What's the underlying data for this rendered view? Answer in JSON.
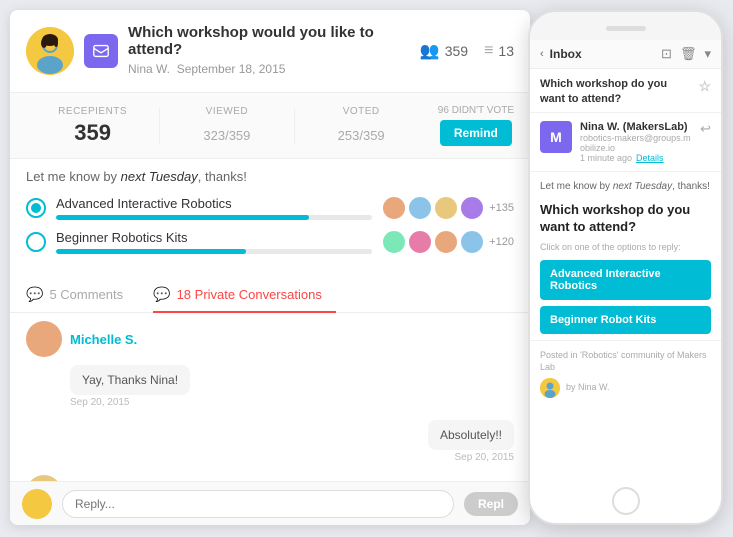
{
  "header": {
    "question": "Which workshop would you like to attend?",
    "author": "Nina W.",
    "date": "September 18, 2015",
    "recipients_count": "359",
    "list_count": "13"
  },
  "stats": {
    "recipients_label": "RECEPIENTS",
    "recipients_value": "359",
    "viewed_label": "VIEWED",
    "viewed_value": "323",
    "viewed_total": "/359",
    "voted_label": "VOTED",
    "voted_value": "253",
    "voted_total": "/359",
    "didnt_vote_label": "96 DIDN'T VOTE",
    "remind_btn": "Remind"
  },
  "poll": {
    "message_before": "Let me know by ",
    "message_italic": "next Tuesday",
    "message_after": ", thanks!",
    "options": [
      {
        "label": "Advanced Interactive Robotics",
        "fill_pct": 80,
        "count": "+135",
        "selected": true
      },
      {
        "label": "Beginner Robotics Kits",
        "fill_pct": 60,
        "count": "+120",
        "selected": false
      }
    ]
  },
  "tabs": [
    {
      "label": "5 Comments",
      "active": false,
      "icon": "💬"
    },
    {
      "label": "18 Private Conversations",
      "active": true,
      "icon": "💬"
    }
  ],
  "comments": [
    {
      "username": "Michelle S.",
      "bubble": "Yay, Thanks Nina!",
      "date": "Sep 20, 2015",
      "align": "left"
    },
    {
      "username": "",
      "bubble": "Absolutely!!",
      "date": "Sep 20, 2015",
      "align": "right"
    }
  ],
  "reply": {
    "placeholder": "Repl...",
    "button_label": "Repl"
  },
  "phone": {
    "inbox_label": "Inbox",
    "subject": "Which workshop do you want to attend?",
    "sender_name": "Nina W. (MakersLab)",
    "sender_email": "robotics-makers@groups.mobilize.io",
    "sender_time": "1 minute ago",
    "sender_detail": "Details",
    "body_italic": "next Tuesday",
    "body_text_before": "Let me know by ",
    "body_text_after": ", thanks!",
    "poll_title": "Which workshop do you want to attend?",
    "poll_subtitle": "Click on one of the options to reply:",
    "option1": "Advanced Interactive Robotics",
    "option2": "Beginner Robot Kits",
    "footer_text": "Posted in 'Robotics' community of Makers Lab",
    "footer_by": "by Nina W."
  }
}
